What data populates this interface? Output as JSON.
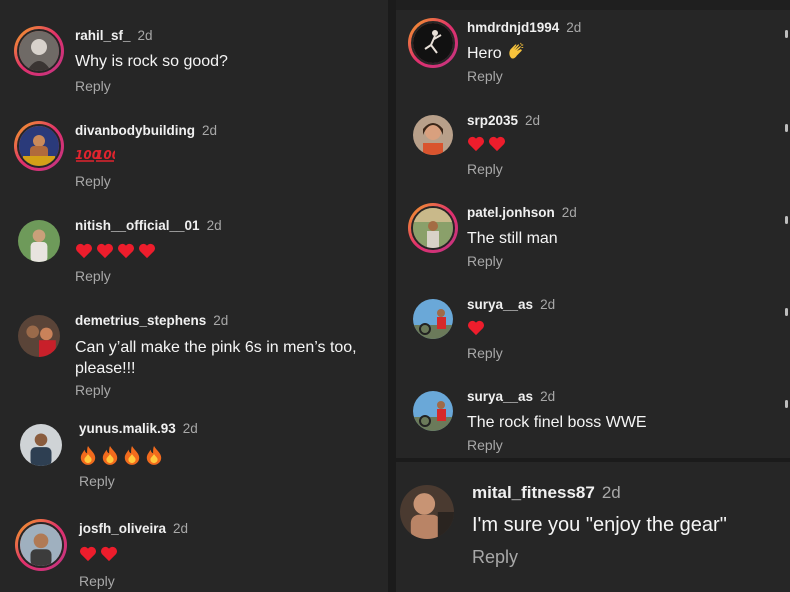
{
  "comments_left": [
    {
      "username": "rahil_sf_",
      "time": "2d",
      "text": "Why is rock so good?",
      "reply": "Reply",
      "emoji": ""
    },
    {
      "username": "divanbodybuilding",
      "time": "2d",
      "text": "",
      "reply": "Reply",
      "emoji": "hundred-hundred"
    },
    {
      "username": "nitish__official__01",
      "time": "2d",
      "text": "",
      "reply": "Reply",
      "emoji": "heart-x4"
    },
    {
      "username": "demetrius_stephens",
      "time": "2d",
      "text": "Can y’all make the pink 6s in men’s too, please!!!",
      "reply": "Reply",
      "emoji": ""
    },
    {
      "username": "yunus.malik.93",
      "time": "2d",
      "text": "",
      "reply": "Reply",
      "emoji": "fire-x4"
    },
    {
      "username": "josfh_oliveira",
      "time": "2d",
      "text": "",
      "reply": "Reply",
      "emoji": "heart-x2"
    }
  ],
  "comments_right": [
    {
      "username": "hmdrdnjd1994",
      "time": "2d",
      "text": "Hero",
      "reply": "Reply",
      "emoji": "clapping-hands"
    },
    {
      "username": "srp2035",
      "time": "2d",
      "text": "",
      "reply": "Reply",
      "emoji": "heart-x2"
    },
    {
      "username": "patel.jonhson",
      "time": "2d",
      "text": "The still man",
      "reply": "Reply",
      "emoji": ""
    },
    {
      "username": "surya__as",
      "time": "2d",
      "text": "",
      "reply": "Reply",
      "emoji": "heart-x1"
    },
    {
      "username": "surya__as",
      "time": "2d",
      "text": "The rock finel boss WWE",
      "reply": "Reply",
      "emoji": ""
    }
  ],
  "comment_bottom": {
    "username": "mital_fitness87",
    "time": "2d",
    "text": "I'm sure you \"enjoy the gear\"",
    "reply": "Reply"
  },
  "colors": {
    "background": "#262626",
    "username": "#f0f0f0",
    "meta": "#a8a8a8",
    "heart": "#ed1d2c",
    "story_ring": "#e1306c"
  }
}
